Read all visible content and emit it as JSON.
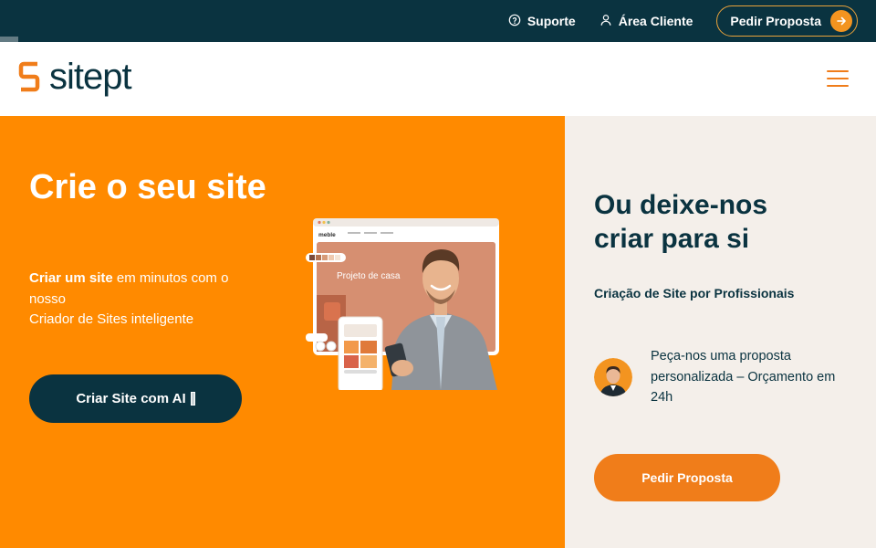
{
  "topbar": {
    "support_label": "Suporte",
    "client_area_label": "Área Cliente",
    "proposal_label": "Pedir Proposta"
  },
  "header": {
    "logo_text": "sitept",
    "menu_icon": "hamburger-icon"
  },
  "left": {
    "title": "Crie o seu site",
    "desc_bold": "Criar um site",
    "desc_rest": " em minutos com o nosso",
    "desc_line2": "Criador de Sites inteligente",
    "button_label": "Criar Site com AI"
  },
  "illustration": {
    "brand": "meble",
    "headline": "Projeto de casa"
  },
  "right": {
    "title": "Ou deixe-nos criar para si",
    "subtitle": "Criação de Site por Profissionais",
    "proposal_text": "Peça-nos uma proposta personalizada – Orçamento em 24h",
    "button_label": "Pedir Proposta"
  },
  "colors": {
    "navy": "#0a3340",
    "orange": "#ff8a00",
    "accent_orange": "#f07d1a",
    "cream": "#f4efea"
  }
}
